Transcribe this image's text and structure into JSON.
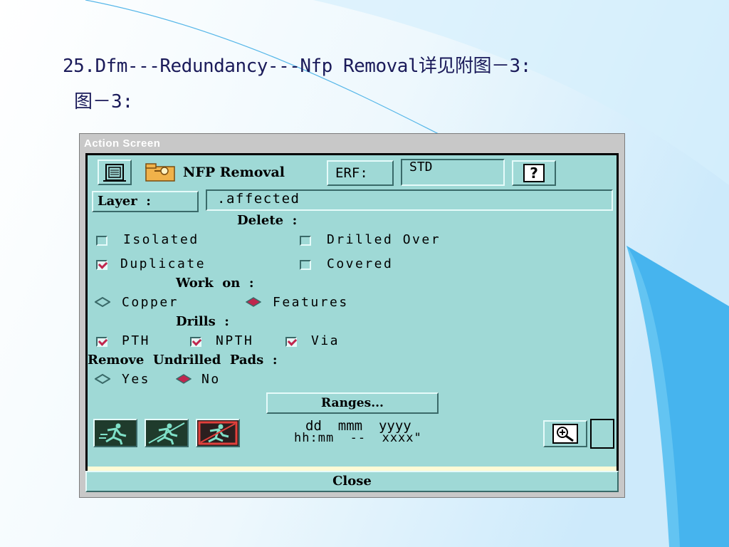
{
  "slide": {
    "title": "25.Dfm---Redundancy---Nfp Removal详见附图－3:",
    "subtitle": "图－3:"
  },
  "window": {
    "title": "Action Screen",
    "action_name": "NFP Removal",
    "erf_label": "ERF:",
    "erf_value": "STD",
    "help_label": "?",
    "layer_label": "Layer  :",
    "layer_value": ".affected",
    "delete_header": "Delete  :",
    "delete_options": [
      {
        "label": "Isolated",
        "checked": false
      },
      {
        "label": "Drilled Over",
        "checked": false
      },
      {
        "label": "Duplicate",
        "checked": true
      },
      {
        "label": "Covered",
        "checked": false
      }
    ],
    "work_on_header": "Work  on  :",
    "work_on_options": [
      {
        "label": "Copper",
        "selected": false
      },
      {
        "label": "Features",
        "selected": true
      }
    ],
    "drills_header": "Drills  :",
    "drills_options": [
      {
        "label": "PTH",
        "checked": true
      },
      {
        "label": "NPTH",
        "checked": true
      },
      {
        "label": "Via",
        "checked": true
      }
    ],
    "undrilled_header": "Remove  Undrilled  Pads  :",
    "undrilled_options": [
      {
        "label": "Yes",
        "selected": false
      },
      {
        "label": "No",
        "selected": true
      }
    ],
    "ranges_label": "Ranges...",
    "date_line": "dd  mmm  yyyy",
    "time_line": "hh:mm  --  xxxx\"",
    "close_label": "Close"
  },
  "colors": {
    "panel": "#9fd9d6",
    "check": "#c0264e",
    "status": "#fffbd6",
    "slide_text": "#1b1b5a"
  }
}
